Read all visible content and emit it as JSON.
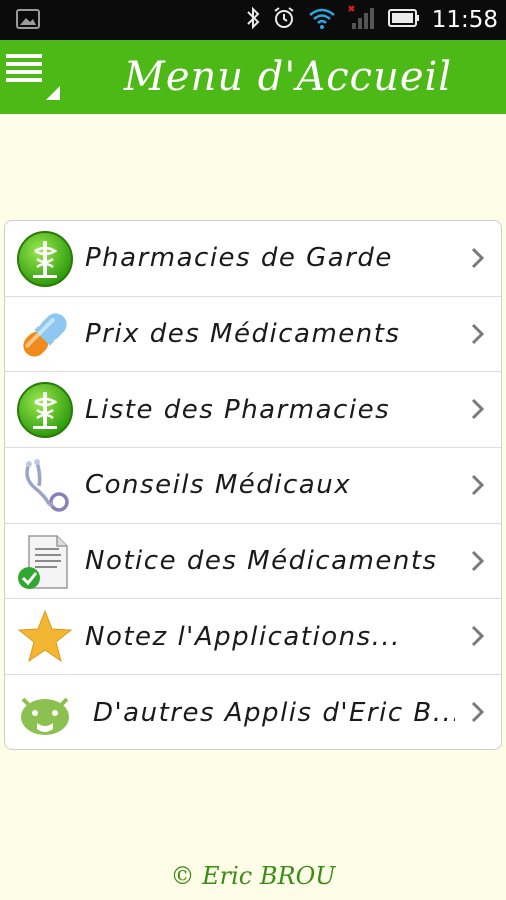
{
  "status_bar": {
    "time": "11:58",
    "icons": [
      "image-icon",
      "bluetooth-icon",
      "alarm-icon",
      "wifi-icon",
      "signal-icon",
      "battery-icon"
    ]
  },
  "action_bar": {
    "title": "Menu d'Accueil",
    "menu_icon": "hamburger-menu-icon",
    "color": "#4cb917"
  },
  "menu": {
    "items": [
      {
        "label": "Pharmacies de Garde",
        "icon": "pharmacy-caduceus-icon"
      },
      {
        "label": "Prix des Médicaments",
        "icon": "pill-capsule-icon"
      },
      {
        "label": "Liste des Pharmacies",
        "icon": "pharmacy-caduceus-icon"
      },
      {
        "label": "Conseils Médicaux",
        "icon": "stethoscope-icon"
      },
      {
        "label": "Notice des Médicaments",
        "icon": "document-check-icon"
      },
      {
        "label": "Notez l'Applications...",
        "icon": "star-icon"
      },
      {
        "label": "D'autres Applis d'Eric B...",
        "icon": "android-icon"
      }
    ]
  },
  "footer": {
    "text": "© Eric BROU"
  },
  "colors": {
    "background": "#fdfde8",
    "accent": "#4cb917",
    "footer_text": "#3a8c12"
  }
}
